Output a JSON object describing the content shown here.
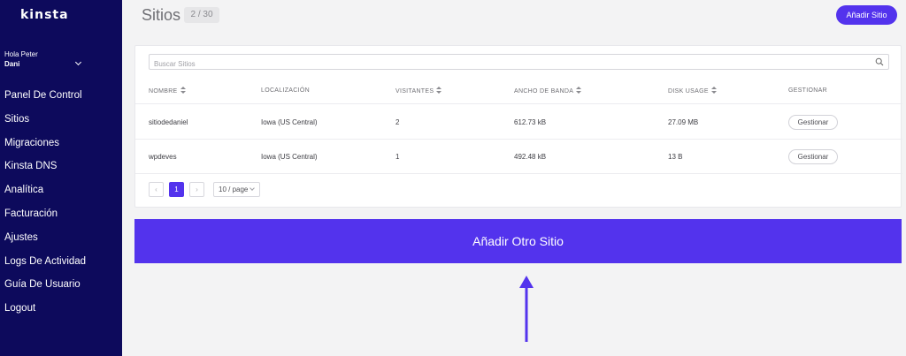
{
  "sidebar": {
    "logo": "kinsta",
    "greeting": "Hola Peter",
    "user_name": "Dani",
    "items": [
      {
        "label": "Panel De Control"
      },
      {
        "label": "Sitios"
      },
      {
        "label": "Migraciones"
      },
      {
        "label": "Kinsta DNS"
      },
      {
        "label": "Analítica"
      },
      {
        "label": "Facturación"
      },
      {
        "label": "Ajustes"
      },
      {
        "label": "Logs De Actividad"
      },
      {
        "label": "Guía De Usuario"
      },
      {
        "label": "Logout"
      }
    ]
  },
  "header": {
    "title": "Sitios",
    "count": "2 / 30",
    "add_button": "Añadir Sitio"
  },
  "search": {
    "placeholder": "Buscar Sitios",
    "value": ""
  },
  "table": {
    "columns": [
      {
        "label": "NOMBRE"
      },
      {
        "label": "LOCALIZACIÓN"
      },
      {
        "label": "VISITANTES"
      },
      {
        "label": "ANCHO DE BANDA"
      },
      {
        "label": "DISK USAGE"
      },
      {
        "label": "GESTIONAR"
      }
    ],
    "rows": [
      {
        "name": "sitiodedaniel",
        "location": "Iowa (US Central)",
        "visitors": "2",
        "bandwidth": "612.73 kB",
        "disk": "27.09 MB",
        "action": "Gestionar"
      },
      {
        "name": "wpdeves",
        "location": "Iowa (US Central)",
        "visitors": "1",
        "bandwidth": "492.48 kB",
        "disk": "13 B",
        "action": "Gestionar"
      }
    ]
  },
  "pagination": {
    "prev": "‹",
    "current": "1",
    "next": "›",
    "page_size": "10 / page"
  },
  "banner": {
    "label": "Añadir Otro Sitio"
  },
  "colors": {
    "sidebar_bg": "#0d0a5c",
    "accent": "#5333ed"
  }
}
